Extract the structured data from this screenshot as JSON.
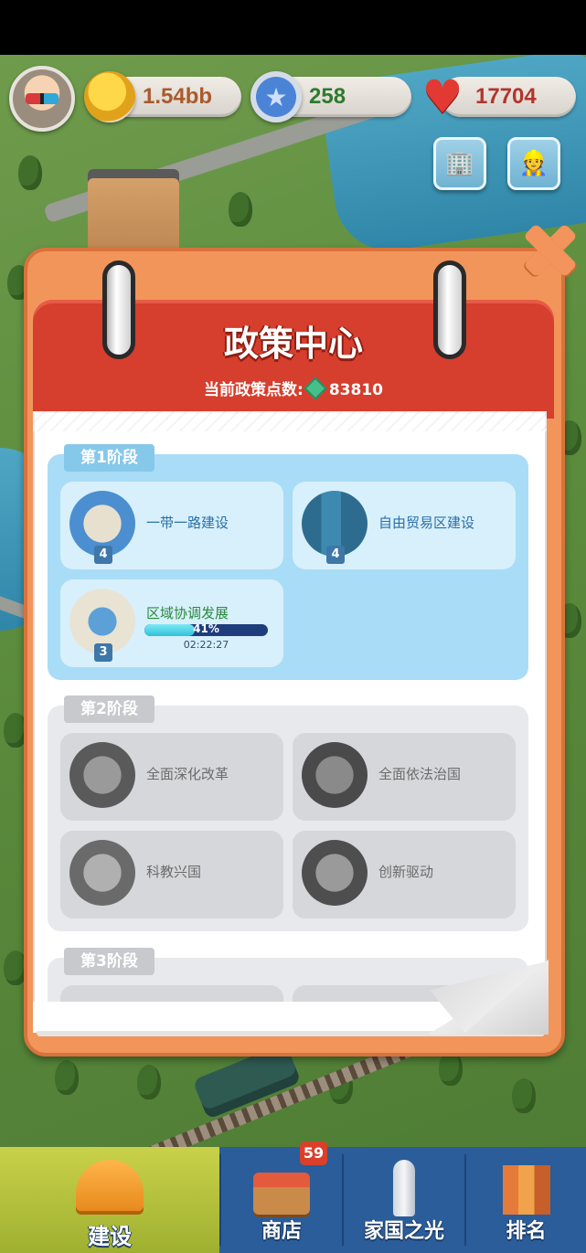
{
  "hud": {
    "coins": "1.54bb",
    "stars": "258",
    "hearts": "17704",
    "coin_color": "#a95a2b",
    "star_color": "#2f7a2f",
    "heart_color": "#b3352b"
  },
  "panel": {
    "title": "政策中心",
    "points_label": "当前政策点数:",
    "points_value": "83810"
  },
  "stages": [
    {
      "label": "第1阶段",
      "policies": [
        {
          "name": "一带一路建设",
          "level": "4"
        },
        {
          "name": "自由贸易区建设",
          "level": "4"
        },
        {
          "name": "区域协调发展",
          "level": "3",
          "progress_text": "41%",
          "progress": 0.41,
          "timer": "02:22:27"
        }
      ]
    },
    {
      "label": "第2阶段",
      "policies": [
        {
          "name": "全面深化改革"
        },
        {
          "name": "全面依法治国"
        },
        {
          "name": "科教兴国"
        },
        {
          "name": "创新驱动"
        }
      ]
    },
    {
      "label": "第3阶段",
      "policies": []
    }
  ],
  "nav": {
    "build": "建设",
    "shop": "商店",
    "shop_badge": "59",
    "homeland": "家国之光",
    "rank": "排名"
  },
  "icons": [
    "avatar",
    "coin-icon",
    "star-icon",
    "heart-icon",
    "building-icon",
    "worker-icon",
    "close-icon",
    "gem-icon",
    "hardhat-icon",
    "shop-icon",
    "rocket-icon",
    "ranking-icon"
  ]
}
